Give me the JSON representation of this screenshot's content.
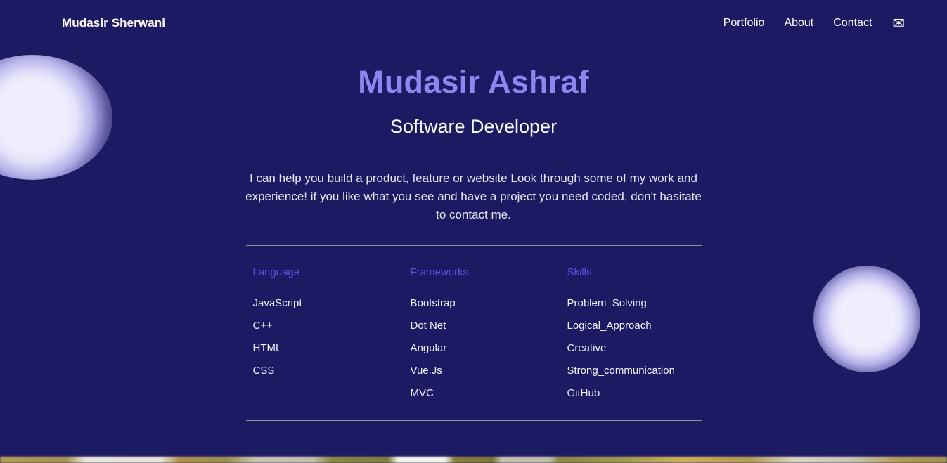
{
  "header": {
    "brand": "Mudasir Sherwani",
    "nav": [
      {
        "label": "Portfolio"
      },
      {
        "label": "About"
      },
      {
        "label": "Contact"
      }
    ],
    "mail_icon": "envelope-icon",
    "mail_glyph": "✉"
  },
  "hero": {
    "title": "Mudasir Ashraf",
    "subtitle": "Software Developer",
    "description": "I can help you build a product, feature or website Look through some of my work and experience! if you like what you see and have a project you need coded, don't hasitate to contact me."
  },
  "skills": {
    "columns": [
      {
        "heading": "Language",
        "items": [
          "JavaScript",
          "C++",
          "HTML",
          "CSS"
        ]
      },
      {
        "heading": "Frameworks",
        "items": [
          "Bootstrap",
          "Dot Net",
          "Angular",
          "Vue.Js",
          "MVC"
        ]
      },
      {
        "heading": "Skills",
        "items": [
          "Problem_Solving",
          "Logical_Approach",
          "Creative",
          "Strong_communication",
          "GitHub"
        ]
      }
    ]
  },
  "colors": {
    "background": "#1b1a63",
    "title_accent": "#8d86f0",
    "column_heading": "#5a52e0",
    "body_text": "#e7e6f4",
    "rule": "#8f8f9e",
    "glow": "#f0eefc"
  }
}
